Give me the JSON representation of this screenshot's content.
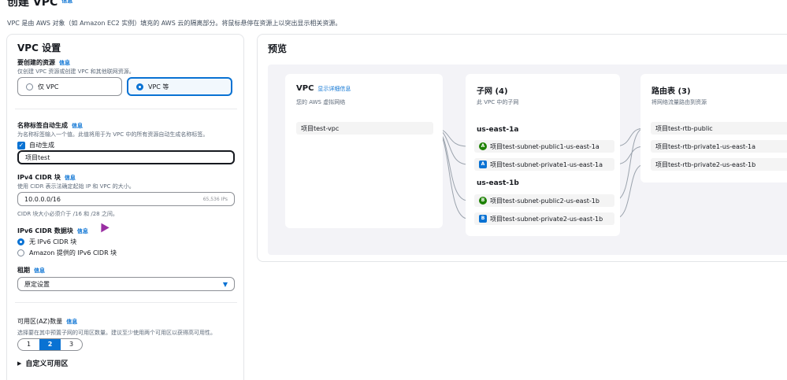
{
  "header": {
    "title": "创建 VPC",
    "title_info": "信息",
    "description": "VPC 是由 AWS 对象（如 Amazon EC2 实例）填充的 AWS 云的隔离部分。将鼠标悬停在资源上以突出显示相关资源。"
  },
  "settings": {
    "title": "VPC 设置",
    "resources": {
      "label": "要创建的资源",
      "info": "信息",
      "desc": "仅创建 VPC 资源或创建 VPC 和其他联网资源。",
      "option_vpc_only": "仅 VPC",
      "option_vpc_more": "VPC 等"
    },
    "name_tag": {
      "label": "名称标签自动生成",
      "info": "信息",
      "desc": "为名称标签输入一个值。此值将用于为 VPC 中的所有资源自动生成名称标签。",
      "auto_label": "自动生成",
      "value": "项目test"
    },
    "ipv4": {
      "label": "IPv4 CIDR 块",
      "info": "信息",
      "desc": "使用 CIDR 表示法确定起始 IP 和 VPC 的大小。",
      "value": "10.0.0.0/16",
      "ips": "65,536 IPs",
      "hint": "CIDR 块大小必须介于 /16 和 /28 之间。"
    },
    "ipv6": {
      "label": "IPv6 CIDR 数据块",
      "info": "信息",
      "option_none": "无 IPv6 CIDR 块",
      "option_amazon": "Amazon 提供的 IPv6 CIDR 块"
    },
    "tenancy": {
      "label": "租期",
      "info": "信息",
      "value": "原定设置"
    },
    "az": {
      "label": "可用区(AZ)数量",
      "info": "信息",
      "desc": "选择要在其中预置子网的可用区数量。建议至少使用两个可用区以获得高可用性。",
      "options": [
        "1",
        "2",
        "3"
      ],
      "selected": "2",
      "customize": "自定义可用区"
    }
  },
  "preview": {
    "title": "预览",
    "vpc": {
      "title": "VPC",
      "link": "显示详细信息",
      "desc": "您的 AWS 虚拟网络",
      "item": "项目test-vpc"
    },
    "subnets": {
      "title": "子网 (4)",
      "desc": "此 VPC 中的子网",
      "az1": "us-east-1a",
      "az2": "us-east-1b",
      "items": [
        {
          "badge": "A",
          "name": "项目test-subnet-public1-us-east-1a"
        },
        {
          "badge": "A",
          "name": "项目test-subnet-private1-us-east-1a"
        },
        {
          "badge": "B",
          "name": "项目test-subnet-public2-us-east-1b"
        },
        {
          "badge": "B",
          "name": "项目test-subnet-private2-us-east-1b"
        }
      ]
    },
    "route_tables": {
      "title": "路由表 (3)",
      "desc": "将网络流量路由到资源",
      "items": [
        "项目test-rtb-public",
        "项目test-rtb-private1-us-east-1a",
        "项目test-rtb-private2-us-east-1b"
      ]
    }
  }
}
